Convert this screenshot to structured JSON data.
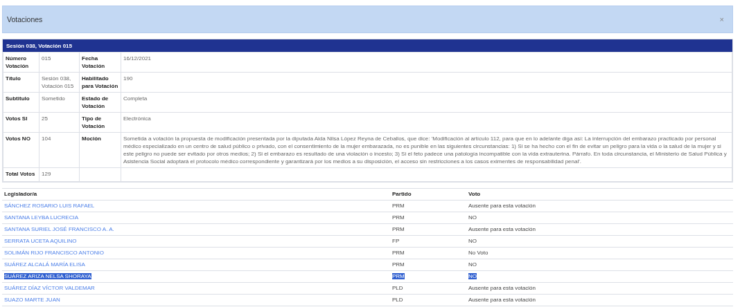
{
  "window": {
    "title": "Votaciones",
    "close": "×"
  },
  "session": {
    "title": "Sesión 038, Votación 015",
    "rows": [
      {
        "label_1": "Número Votación",
        "value_1": "015",
        "label_2": "Fecha Votación",
        "value_2": "16/12/2021"
      },
      {
        "label_1": "Título",
        "value_1": "Sesión 038, Votación 015",
        "label_2": "Habilitado para Votación",
        "value_2": "190"
      },
      {
        "label_1": "Subtitulo",
        "value_1": "Sometido",
        "label_2": "Estado de Votación",
        "value_2": "Completa"
      },
      {
        "label_1": "Votos SI",
        "value_1": "25",
        "label_2": "Tipo de Votación",
        "value_2": "Electrónica"
      },
      {
        "label_1": "Votos NO",
        "value_1": "104",
        "label_2": "Moción",
        "value_2": "Sometida a votación la propuesta de modificación presentada por la diputada Aida Nilsa López Reyna de Ceballos, que dice: 'Modificación al artículo 112, para que en lo adelante diga así: La interrupción del embarazo practicado por personal médico especializado en un centro de salud público o privado, con el consentimiento de la mujer embarazada, no es punible en las siguientes circunstancias: 1) Si se ha hecho con el fin de evitar un peligro para la vida o la salud de la mujer y si este peligro no puede ser evitado por otros medios; 2) Si el embarazo es resultado de una violación o incesto; 3) Si el feto padece una patología incompatible con la vida extrauterina. Párrafo. En toda circunstancia, el Ministerio de Salud Pública y Asistencia Social adoptará el protocolo médico correspondiente y garantizará por los medios a su disposición, el acceso sin restricciones a los casos eximentes de responsabilidad penal'."
      },
      {
        "label_1": "Total Votos",
        "value_1": "129"
      }
    ]
  },
  "votes": {
    "columns": [
      "Legislador/a",
      "Partido",
      "Voto"
    ],
    "rows": [
      {
        "name": "SÁNCHEZ ROSARIO LUIS RAFAEL",
        "party": "PRM",
        "vote": "Ausente para esta votación",
        "selected": false
      },
      {
        "name": "SANTANA LEYBA LUCRECIA",
        "party": "PRM",
        "vote": "NO",
        "selected": false
      },
      {
        "name": "SANTANA SURIEL JOSÉ FRANCISCO A. A.",
        "party": "PRM",
        "vote": "Ausente para esta votación",
        "selected": false
      },
      {
        "name": "SERRATA UCETA AQUILINO",
        "party": "FP",
        "vote": "NO",
        "selected": false
      },
      {
        "name": "SOLIMÁN RIJO FRANCISCO ANTONIO",
        "party": "PRM",
        "vote": "No Voto",
        "selected": false
      },
      {
        "name": "SUÁREZ ALCALÁ MARÍA ELISA",
        "party": "PRM",
        "vote": "NO",
        "selected": false
      },
      {
        "name": "SUÁREZ ARIZA NELSA SHORAYA",
        "party": "PRM",
        "vote": "NO",
        "selected": true
      },
      {
        "name": "SUÁREZ DÍAZ VÍCTOR VALDEMAR",
        "party": "PLD",
        "vote": "Ausente para esta votación",
        "selected": false
      },
      {
        "name": "SUAZO MARTE JUAN",
        "party": "PLD",
        "vote": "Ausente para esta votación",
        "selected": false
      }
    ]
  }
}
